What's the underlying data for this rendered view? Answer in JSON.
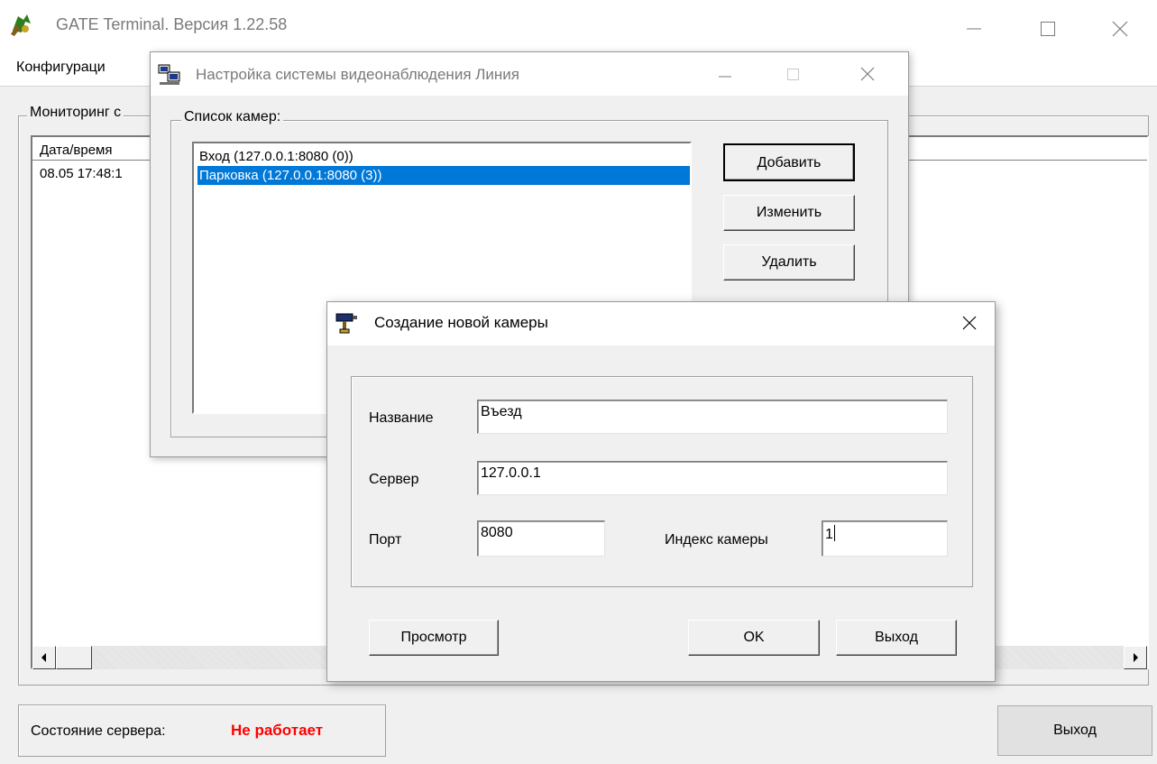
{
  "main": {
    "title": "GATE Terminal.  Версия 1.22.58",
    "menu": {
      "config": "Конфигураци"
    },
    "monitor_legend": "Мониторинг с",
    "log": {
      "columns": [
        "Дата/время"
      ],
      "rows": [
        [
          "08.05  17:48:1"
        ]
      ]
    },
    "status": {
      "label": "Состояние сервера:",
      "value": "Не работает",
      "value_color": "#ff0000"
    },
    "exit_label": "Выход"
  },
  "video_dialog": {
    "title": "Настройка системы видеонаблюдения Линия",
    "cameras_legend": "Список камер:",
    "cameras": [
      {
        "label": "Вход (127.0.0.1:8080 (0))",
        "selected": false
      },
      {
        "label": "Парковка (127.0.0.1:8080 (3))",
        "selected": true
      }
    ],
    "buttons": {
      "add": "Добавить",
      "edit": "Изменить",
      "delete": "Удалить"
    }
  },
  "camera_dialog": {
    "title": "Создание новой камеры",
    "fields": {
      "name": {
        "label": "Название",
        "value": "Въезд"
      },
      "server": {
        "label": "Сервер",
        "value": "127.0.0.1"
      },
      "port": {
        "label": "Порт",
        "value": "8080"
      },
      "index": {
        "label": "Индекс камеры",
        "value": "1"
      }
    },
    "buttons": {
      "preview": "Просмотр",
      "ok": "OK",
      "exit": "Выход"
    }
  },
  "colors": {
    "selection": "#0078d7",
    "status_error": "#ff0000"
  },
  "icons": [
    "gate-app-icon",
    "network-computers-icon",
    "camera-icon"
  ]
}
